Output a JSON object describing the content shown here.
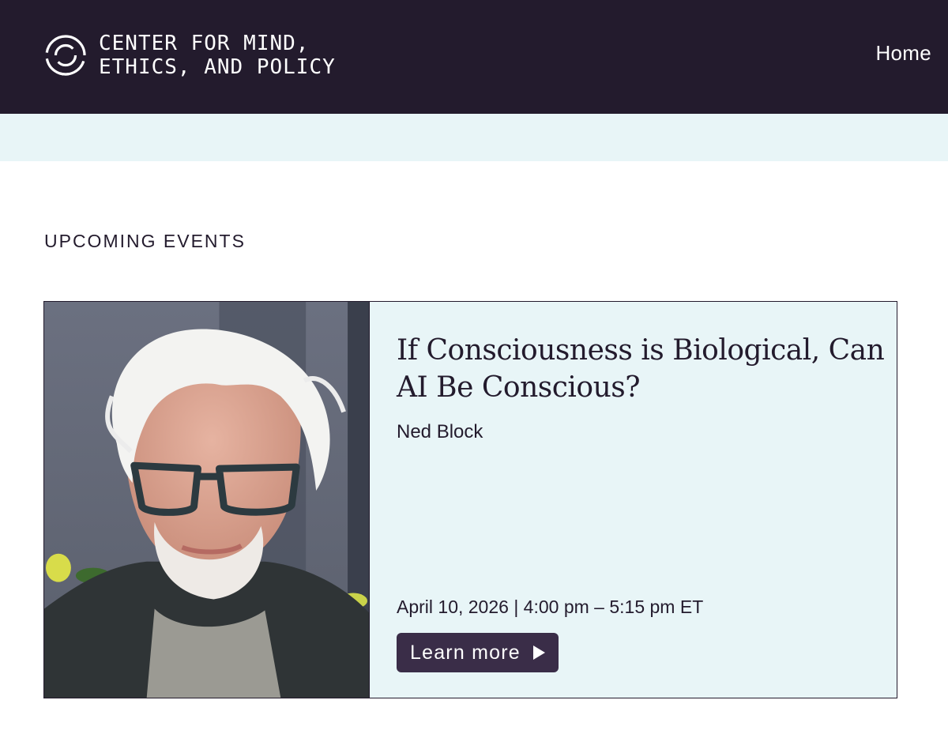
{
  "header": {
    "logo_line1": "CENTER FOR MIND,",
    "logo_line2": "ETHICS, AND POLICY",
    "logo_icon": "circle-logo-icon",
    "nav_home": "Home",
    "background": "#231b2d"
  },
  "band": {
    "background": "#e8f5f7"
  },
  "upcoming": {
    "heading": "UPCOMING EVENTS",
    "event": {
      "title": "If Consciousness is Biological, Can AI Be Conscious?",
      "speaker": "Ned Block",
      "datetime": "April 10, 2026 | 4:00 pm – 5:15 pm ET",
      "cta_label": "Learn more",
      "cta_icon": "play-triangle-icon",
      "card_background": "#e8f5f7",
      "button_background": "#3a2d48"
    }
  }
}
